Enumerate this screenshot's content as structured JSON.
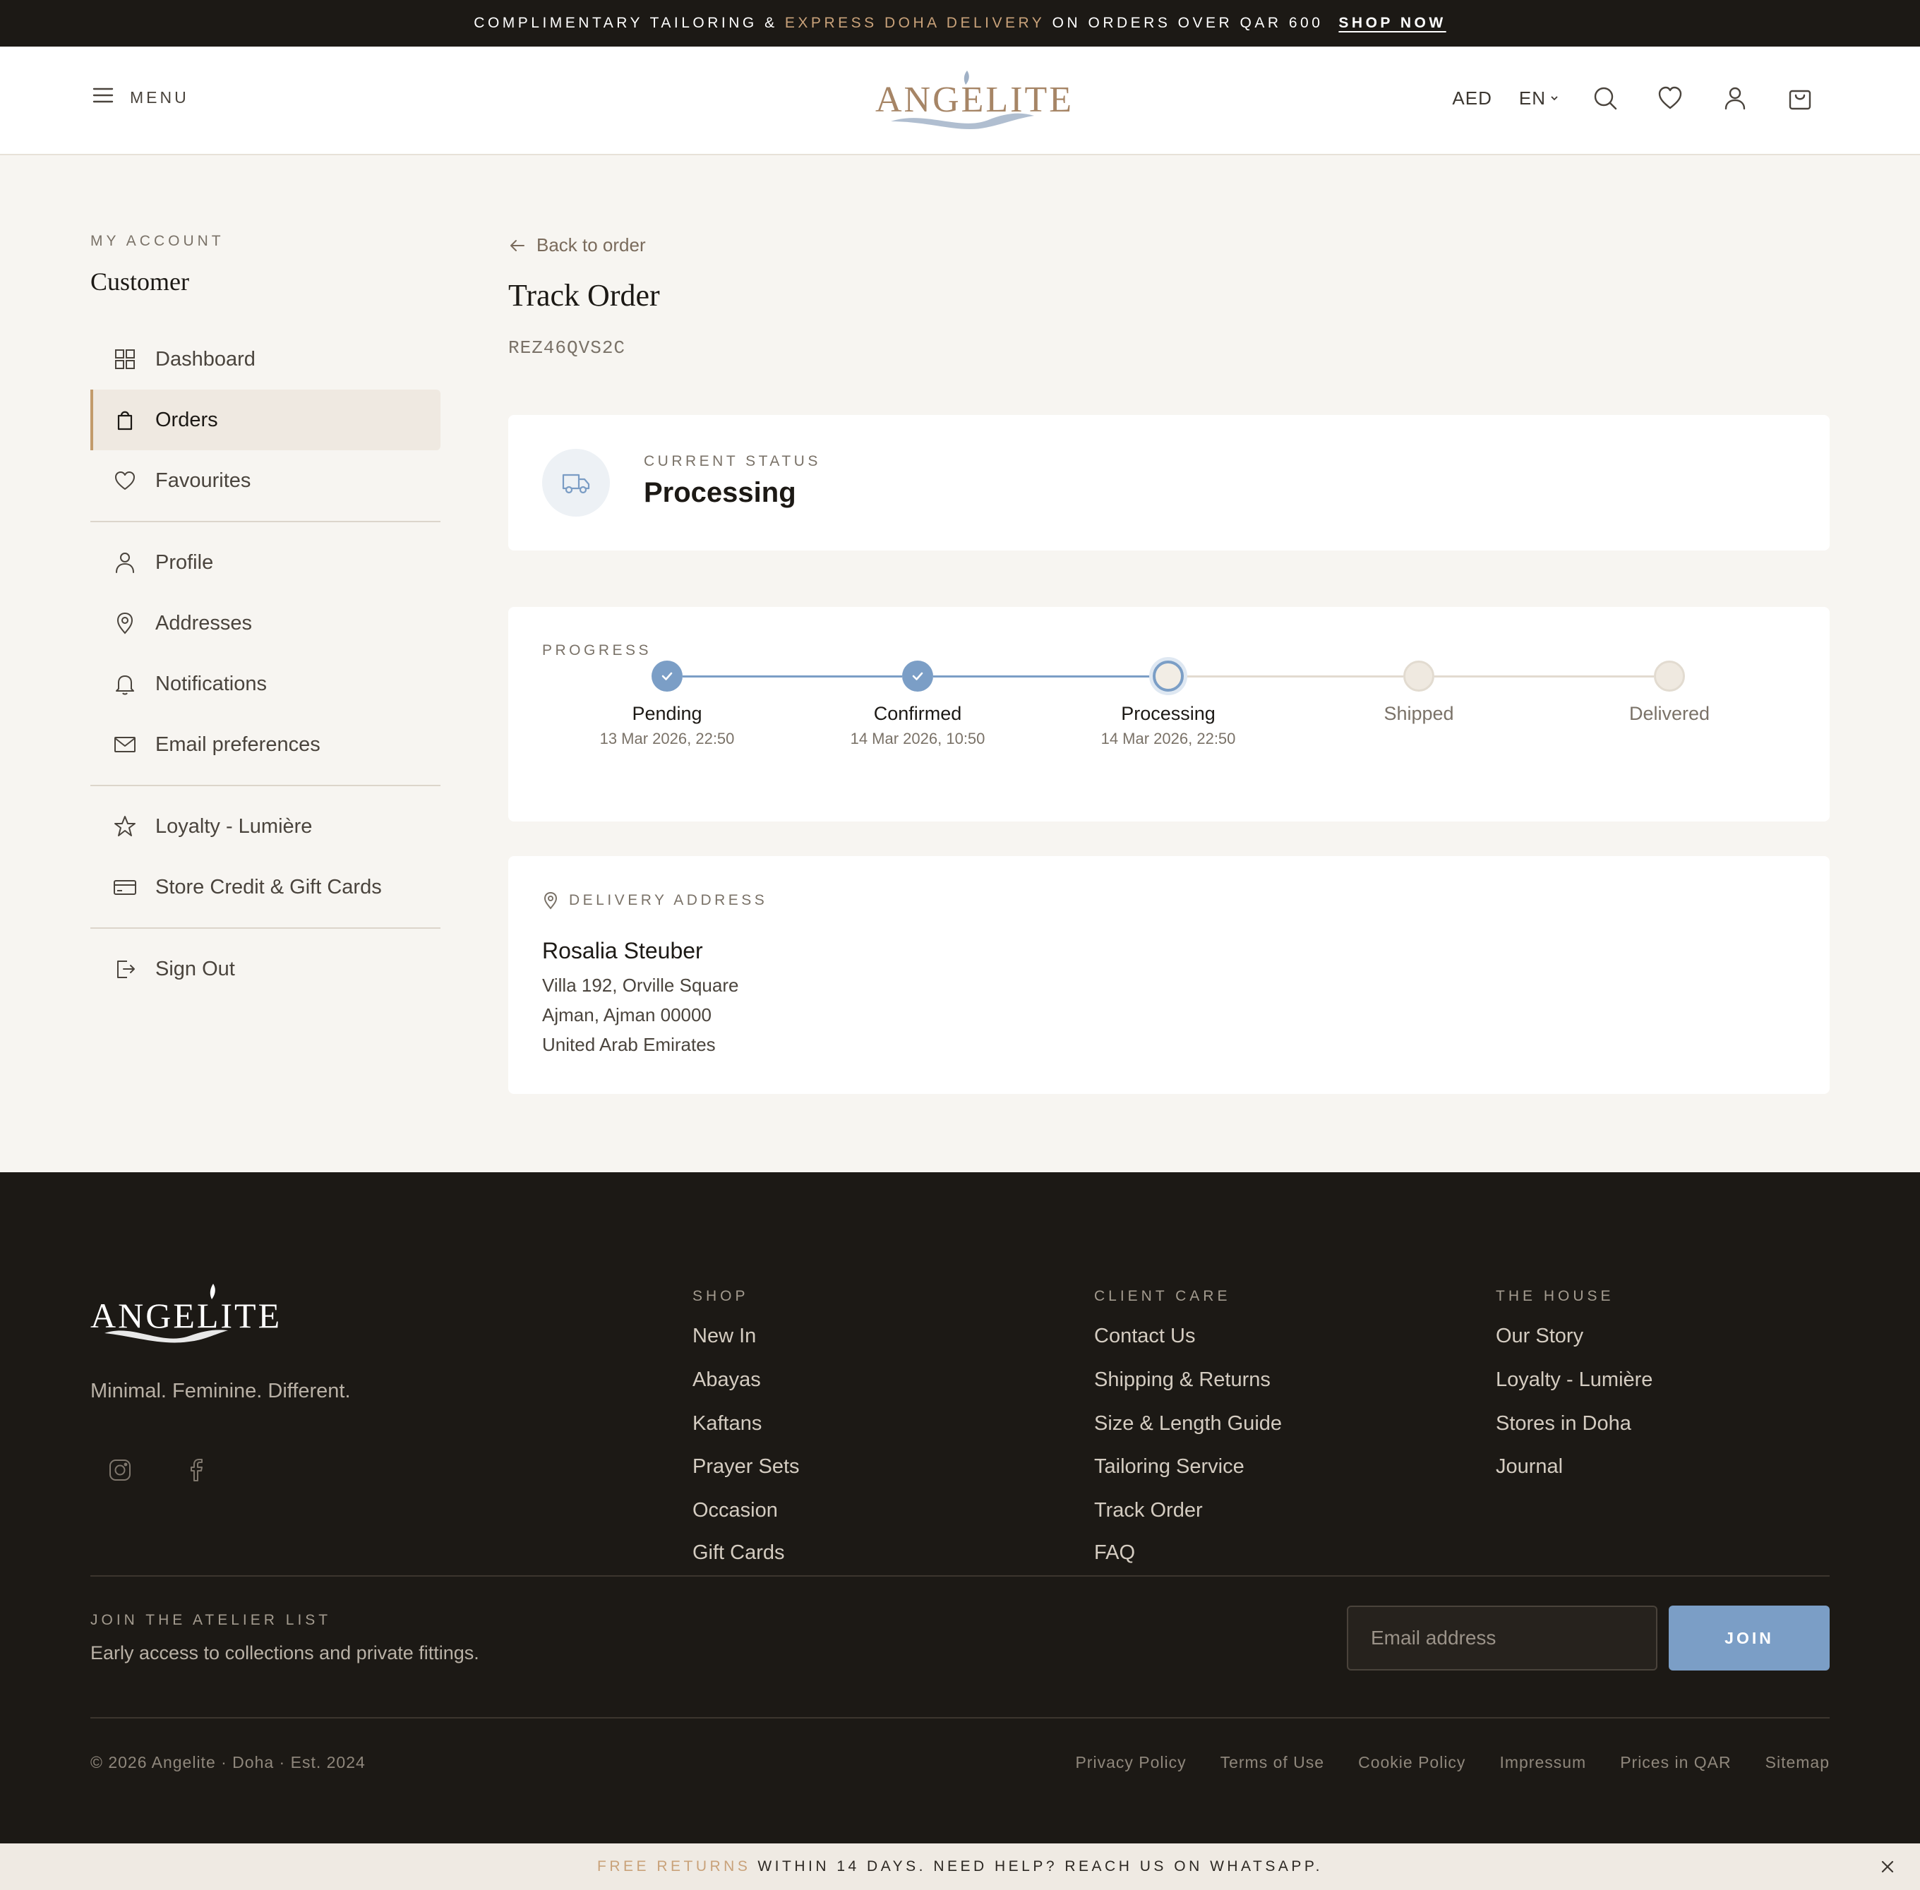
{
  "announcement": {
    "prefix": "COMPLIMENTARY TAILORING & ",
    "highlight": "EXPRESS DOHA DELIVERY",
    "suffix": " ON ORDERS OVER QAR 600",
    "cta": "SHOP NOW"
  },
  "header": {
    "menu_label": "MENU",
    "logo_text": "ANGELITE",
    "currency": "AED",
    "language": "EN",
    "icons": [
      "search-icon",
      "heart-icon",
      "user-icon",
      "bag-icon"
    ]
  },
  "sidebar": {
    "section_label": "MY ACCOUNT",
    "customer_name": "Customer",
    "items": [
      {
        "label": "Dashboard",
        "icon": "grid-icon",
        "active": false
      },
      {
        "label": "Orders",
        "icon": "bag-icon",
        "active": true
      },
      {
        "label": "Favourites",
        "icon": "heart-icon",
        "active": false
      },
      {
        "label": "Profile",
        "icon": "user-icon",
        "active": false
      },
      {
        "label": "Addresses",
        "icon": "pin-icon",
        "active": false
      },
      {
        "label": "Notifications",
        "icon": "bell-icon",
        "active": false
      },
      {
        "label": "Email preferences",
        "icon": "mail-icon",
        "active": false
      },
      {
        "label": "Loyalty - Lumière",
        "icon": "star-icon",
        "active": false
      },
      {
        "label": "Store Credit & Gift Cards",
        "icon": "card-icon",
        "active": false
      },
      {
        "label": "Sign Out",
        "icon": "sign-out-icon",
        "active": false
      }
    ]
  },
  "main": {
    "back_label": "Back to order",
    "title": "Track Order",
    "order_code": "REZ46QVS2C",
    "status": {
      "label": "CURRENT STATUS",
      "value": "Processing",
      "icon": "truck-icon"
    },
    "progress": {
      "label": "PROGRESS",
      "steps": [
        {
          "name": "Pending",
          "date": "13 Mar 2026, 22:50",
          "state": "done"
        },
        {
          "name": "Confirmed",
          "date": "14 Mar 2026, 10:50",
          "state": "done"
        },
        {
          "name": "Processing",
          "date": "14 Mar 2026, 22:50",
          "state": "current"
        },
        {
          "name": "Shipped",
          "date": "",
          "state": "pending"
        },
        {
          "name": "Delivered",
          "date": "",
          "state": "pending"
        }
      ]
    },
    "delivery": {
      "label": "DELIVERY ADDRESS",
      "name": "Rosalia Steuber",
      "lines": [
        "Villa 192, Orville Square",
        "Ajman, Ajman 00000",
        "United Arab Emirates"
      ]
    }
  },
  "footer": {
    "logo_text": "ANGELITE",
    "tagline": "Minimal. Feminine. Different.",
    "social": [
      "instagram-icon",
      "facebook-icon"
    ],
    "columns": [
      {
        "heading": "SHOP",
        "links": [
          "New In",
          "Abayas",
          "Kaftans",
          "Prayer Sets",
          "Occasion",
          "Gift Cards"
        ]
      },
      {
        "heading": "CLIENT CARE",
        "links": [
          "Contact Us",
          "Shipping & Returns",
          "Size & Length Guide",
          "Tailoring Service",
          "Track Order",
          "FAQ"
        ]
      },
      {
        "heading": "THE HOUSE",
        "links": [
          "Our Story",
          "Loyalty - Lumière",
          "Stores in Doha",
          "Journal"
        ]
      }
    ],
    "newsletter": {
      "label": "JOIN THE ATELIER LIST",
      "subtitle": "Early access to collections and private fittings.",
      "placeholder": "Email address",
      "button": "JOIN"
    },
    "copyright": "© 2026 Angelite · Doha · Est. 2024",
    "legal_links": [
      "Privacy Policy",
      "Terms of Use",
      "Cookie Policy",
      "Impressum",
      "Prices in QAR",
      "Sitemap"
    ]
  },
  "bottom_bar": {
    "highlight": "FREE RETURNS",
    "text": "WITHIN 14 DAYS. NEED HELP? REACH US ON WHATSAPP."
  },
  "colors": {
    "accent_blue": "#7b9ec6",
    "gold": "#c9a27a",
    "dark": "#1c1915",
    "background": "#f7f5f1"
  }
}
